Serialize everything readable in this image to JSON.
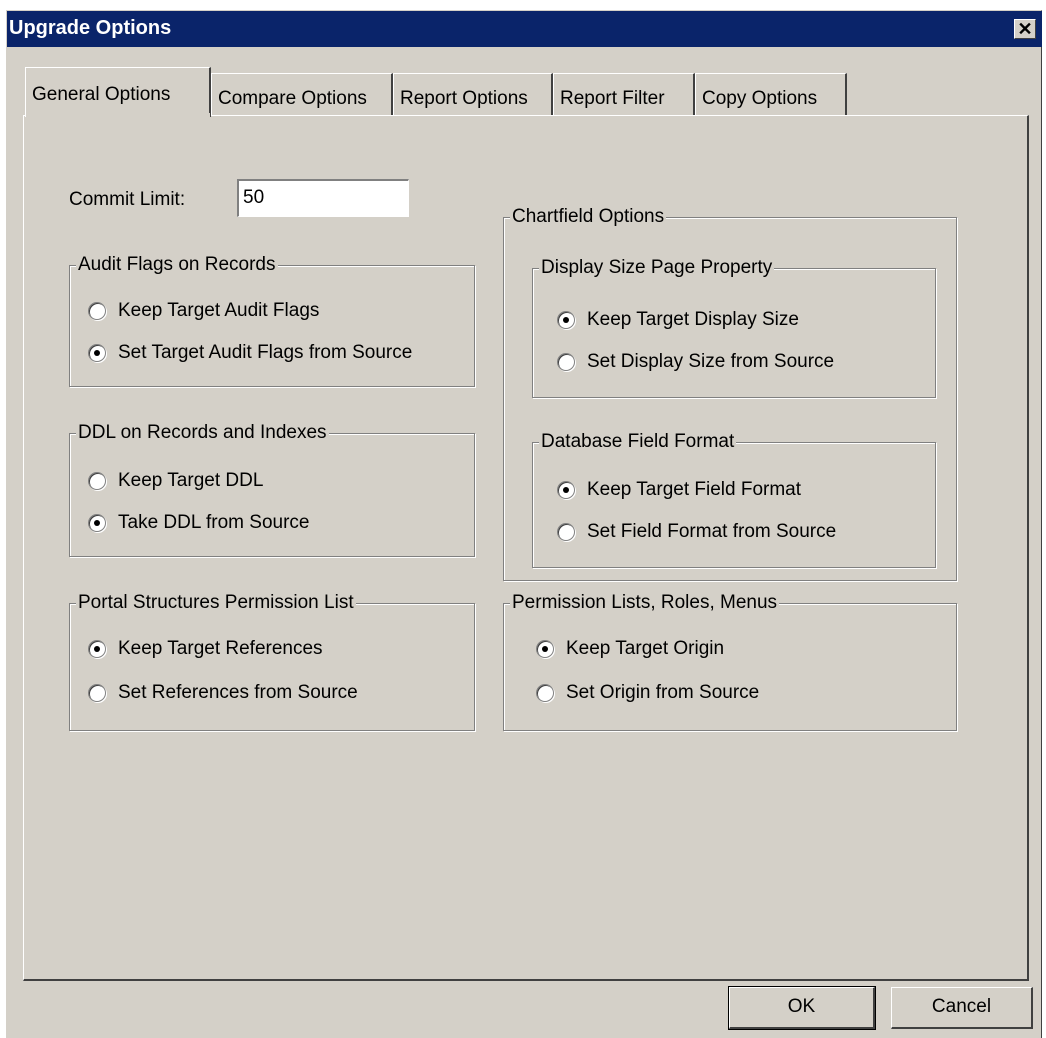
{
  "window": {
    "title": "Upgrade Options",
    "close_glyph": "✕"
  },
  "tabs": [
    {
      "label": "General Options",
      "active": true
    },
    {
      "label": "Compare Options",
      "active": false
    },
    {
      "label": "Report Options",
      "active": false
    },
    {
      "label": "Report Filter",
      "active": false
    },
    {
      "label": "Copy Options",
      "active": false
    }
  ],
  "commit_limit": {
    "label": "Commit Limit:",
    "value": "50"
  },
  "audit_flags": {
    "title": "Audit Flags on Records",
    "options": [
      {
        "label": "Keep Target Audit Flags",
        "checked": false
      },
      {
        "label": "Set Target Audit Flags from Source",
        "checked": true
      }
    ]
  },
  "ddl": {
    "title": "DDL on Records and Indexes",
    "options": [
      {
        "label": "Keep Target DDL",
        "checked": false
      },
      {
        "label": "Take DDL from Source",
        "checked": true
      }
    ]
  },
  "portal": {
    "title": "Portal Structures Permission List",
    "options": [
      {
        "label": "Keep Target References",
        "checked": true
      },
      {
        "label": "Set References from Source",
        "checked": false
      }
    ]
  },
  "chartfield": {
    "title": "Chartfield Options",
    "display_size": {
      "title": "Display Size Page Property",
      "options": [
        {
          "label": "Keep Target Display Size",
          "checked": true
        },
        {
          "label": "Set Display Size from Source",
          "checked": false
        }
      ]
    },
    "field_format": {
      "title": "Database Field Format",
      "options": [
        {
          "label": "Keep Target Field Format",
          "checked": true
        },
        {
          "label": "Set Field Format from Source",
          "checked": false
        }
      ]
    }
  },
  "permission_lists": {
    "title": "Permission Lists, Roles, Menus",
    "options": [
      {
        "label": "Keep Target Origin",
        "checked": true
      },
      {
        "label": "Set Origin from Source",
        "checked": false
      }
    ]
  },
  "buttons": {
    "ok": "OK",
    "cancel": "Cancel"
  }
}
